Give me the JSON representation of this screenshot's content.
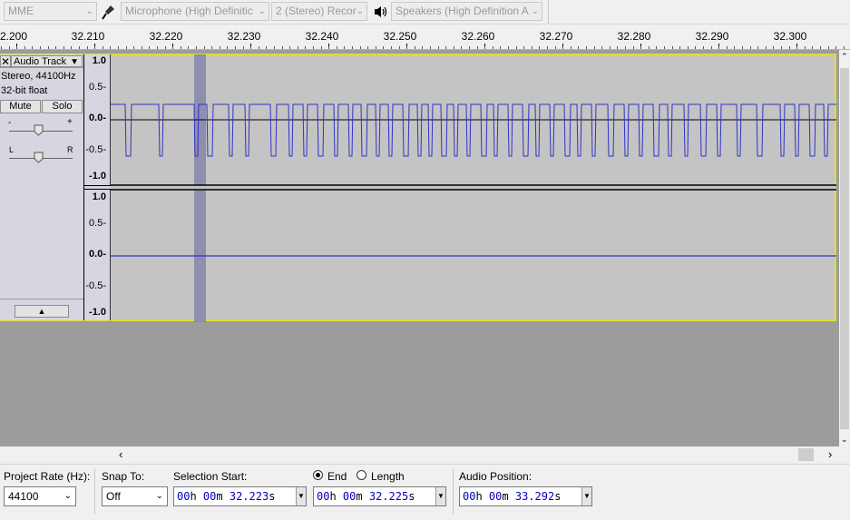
{
  "device_toolbar": {
    "host": "MME",
    "recording_device": "Microphone (High Definitic",
    "recording_channels": "2 (Stereo) Recor",
    "playback_device": "Speakers (High Definition A"
  },
  "timeline": {
    "labels": [
      "2.200",
      "32.210",
      "32.220",
      "32.230",
      "32.240",
      "32.250",
      "32.260",
      "32.270",
      "32.280",
      "32.290",
      "32.300"
    ]
  },
  "track": {
    "name": "Audio Track",
    "info_rate": "Stereo, 44100Hz",
    "info_format": "32-bit float",
    "mute_label": "Mute",
    "solo_label": "Solo",
    "gain_minus": "-",
    "gain_plus": "+",
    "pan_left": "L",
    "pan_right": "R",
    "ruler_labels": [
      "1.0",
      "0.5-",
      "0.0-",
      "-0.5-",
      "-1.0"
    ]
  },
  "selection_toolbar": {
    "project_rate_label": "Project Rate (Hz):",
    "project_rate_value": "44100",
    "snap_to_label": "Snap To:",
    "snap_to_value": "Off",
    "selection_start_label": "Selection Start:",
    "end_label": "End",
    "length_label": "Length",
    "audio_position_label": "Audio Position:",
    "selection_start": {
      "h": "00",
      "m": "00",
      "s": "32.223"
    },
    "selection_end": {
      "h": "00",
      "m": "00",
      "s": "32.225"
    },
    "audio_position": {
      "h": "00",
      "m": "00",
      "s": "33.292"
    },
    "unit_h": "h",
    "unit_m": "m",
    "unit_s": "s"
  },
  "colors": {
    "waveform": "#3232c8",
    "track_bg": "#c4c4c4",
    "selection_band": "#8e8eae",
    "focus_border": "#e1dd33"
  }
}
